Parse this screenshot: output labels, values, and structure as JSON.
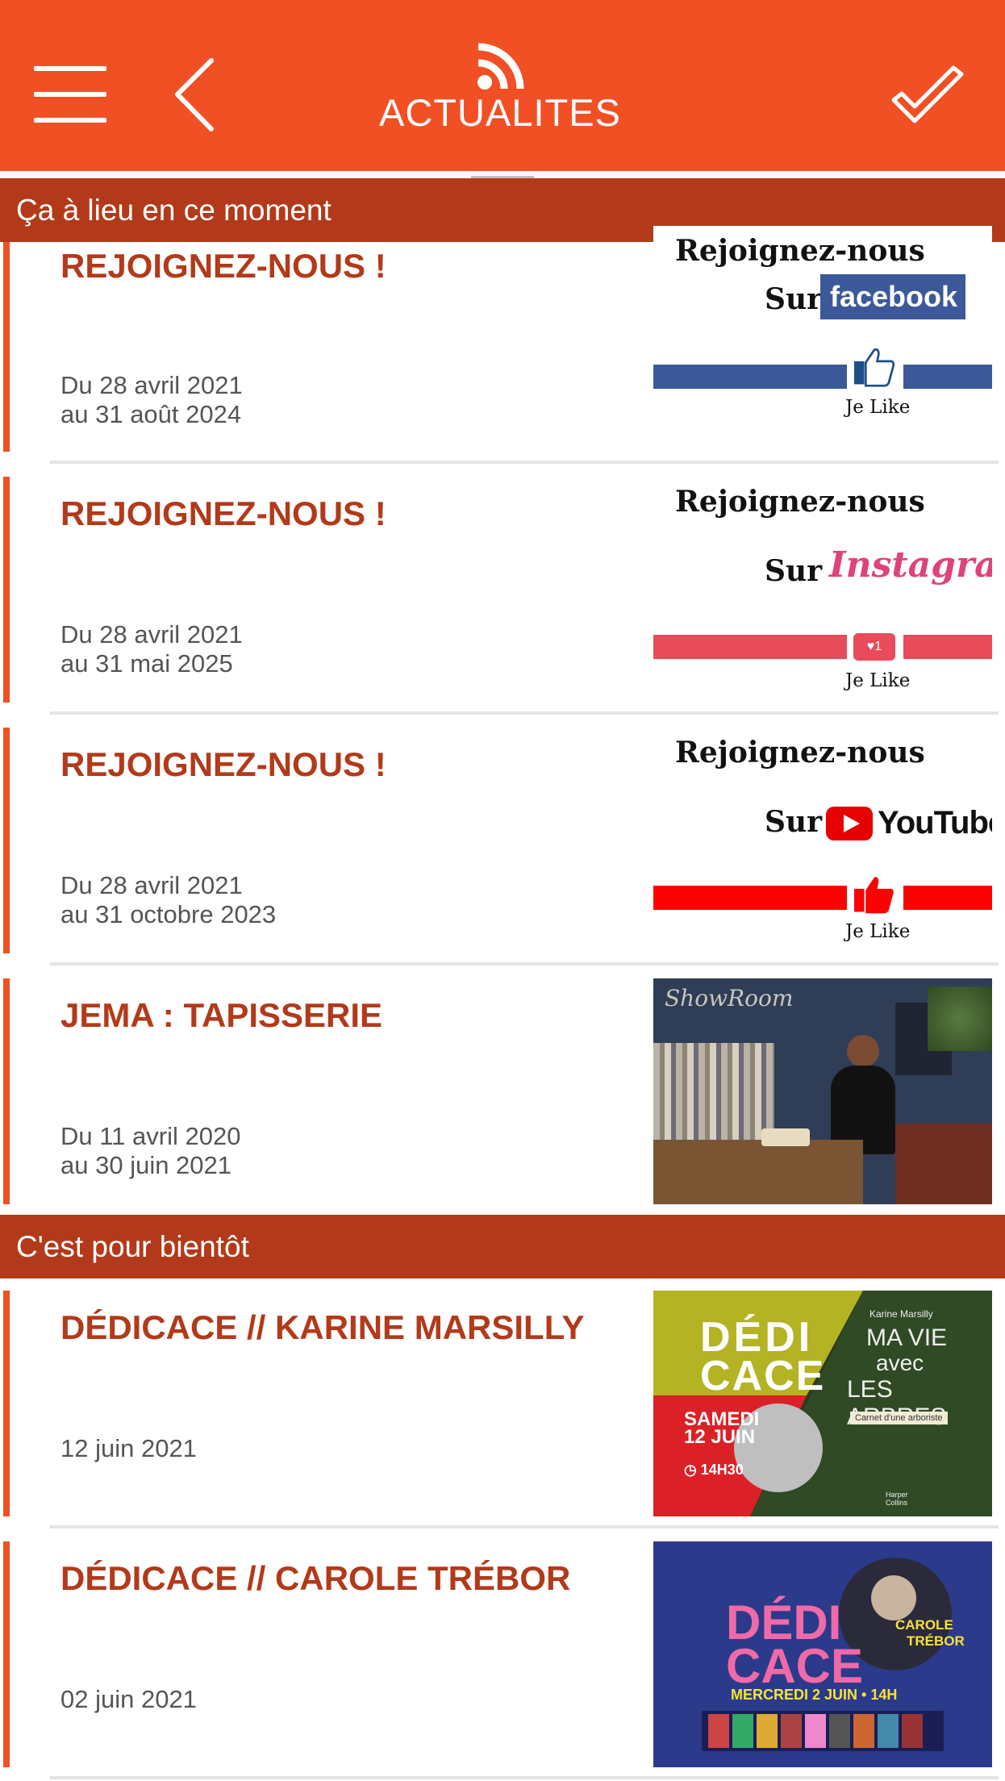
{
  "header": {
    "title": "ACTUALITES",
    "colors": {
      "primary": "#f15025",
      "section": "#b23a1a",
      "title_text": "#b23a1a"
    }
  },
  "sections": [
    {
      "label": "Ça à lieu en ce moment",
      "items": [
        {
          "title": "REJOIGNEZ-NOUS !",
          "date_line1": "Du 28 avril 2021",
          "date_line2": "au 31 août 2024",
          "thumbnail": {
            "type": "social",
            "heading": "Rejoignez-nous",
            "sur": "Sur",
            "brand": "facebook",
            "like": "Je Like",
            "bar_color": "#3b5998"
          }
        },
        {
          "title": "REJOIGNEZ-NOUS !",
          "date_line1": "Du 28 avril 2021",
          "date_line2": "au 31 mai 2025",
          "thumbnail": {
            "type": "social",
            "heading": "Rejoignez-nous",
            "sur": "Sur",
            "brand": "Instagram",
            "like": "Je Like",
            "badge": "1",
            "bar_color": "#e84b5a"
          }
        },
        {
          "title": "REJOIGNEZ-NOUS !",
          "date_line1": "Du 28 avril 2021",
          "date_line2": "au 31 octobre 2023",
          "thumbnail": {
            "type": "social",
            "heading": "Rejoignez-nous",
            "sur": "Sur",
            "brand": "YouTube",
            "like": "Je Like",
            "bar_color": "#ff0000"
          }
        },
        {
          "title": "JEMA : TAPISSERIE",
          "date_line1": "Du 11 avril 2020",
          "date_line2": "au 30 juin 2021",
          "thumbnail": {
            "type": "photo",
            "sign": "ShowRoom"
          }
        }
      ]
    },
    {
      "label": "C'est pour bientôt",
      "items": [
        {
          "title": "DÉDICACE // KARINE MARSILLY",
          "date_line1": "12 juin 2021",
          "thumbnail": {
            "type": "poster",
            "big1": "DÉDI",
            "big2": "CACE",
            "day1": "SAMEDI",
            "day2": "12 JUIN",
            "time": "14H30",
            "author": "Karine Marsilly",
            "book1": "MA VIE",
            "book2": "avec",
            "book3": "LES ARBRES",
            "subtitle": "Carnet d'une arboriste",
            "publisher1": "Harper",
            "publisher2": "Collins"
          }
        },
        {
          "title": "DÉDICACE // CAROLE TRÉBOR",
          "date_line1": "02 juin 2021",
          "thumbnail": {
            "type": "poster",
            "big1": "DÉDI",
            "big2": "CACE",
            "name1": "CAROLE",
            "name2": "TRÉBOR",
            "when": "MERCREDI 2 JUIN • 14H"
          }
        }
      ]
    }
  ]
}
